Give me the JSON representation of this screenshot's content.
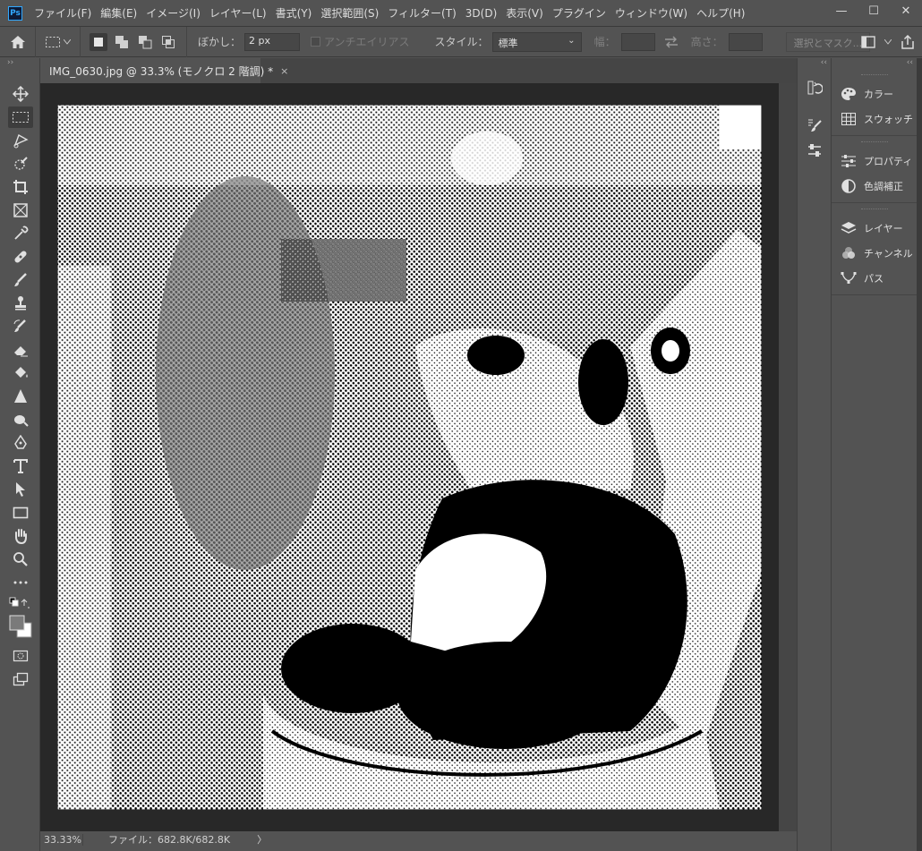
{
  "app": {
    "logo": "Ps"
  },
  "menu": [
    "ファイル(F)",
    "編集(E)",
    "イメージ(I)",
    "レイヤー(L)",
    "書式(Y)",
    "選択範囲(S)",
    "フィルター(T)",
    "3D(D)",
    "表示(V)",
    "プラグイン",
    "ウィンドウ(W)",
    "ヘルプ(H)"
  ],
  "window_controls": {
    "minimize": "—",
    "maximize": "☐",
    "close": "✕"
  },
  "options": {
    "feather_label": "ぼかし：",
    "feather_value": "2 px",
    "antialias_label": "アンチエイリアス",
    "style_label": "スタイル：",
    "style_value": "標準",
    "width_label": "幅：",
    "height_label": "高さ：",
    "mask_button": "選択とマスク..."
  },
  "document": {
    "tab_title": "IMG_0630.jpg @ 33.3% (モノクロ 2 階調) *",
    "close": "×"
  },
  "status": {
    "zoom": "33.33%",
    "file_info": "ファイル：682.8K/682.8K",
    "arrow": "〉"
  },
  "panels": {
    "collapse": "‹‹",
    "group1": [
      {
        "label": "カラー",
        "icon": "palette-icon"
      },
      {
        "label": "スウォッチ",
        "icon": "grid-icon"
      }
    ],
    "group2": [
      {
        "label": "プロパティ",
        "icon": "sliders-icon"
      },
      {
        "label": "色調補正",
        "icon": "half-circle-icon"
      }
    ],
    "group3": [
      {
        "label": "レイヤー",
        "icon": "layers-icon"
      },
      {
        "label": "チャンネル",
        "icon": "channels-icon"
      },
      {
        "label": "パス",
        "icon": "path-icon"
      }
    ]
  },
  "toolbox_expand": "››",
  "colors": {
    "ui_bg": "#535353",
    "canvas_bg": "#282828",
    "accent": "#31a8ff"
  }
}
